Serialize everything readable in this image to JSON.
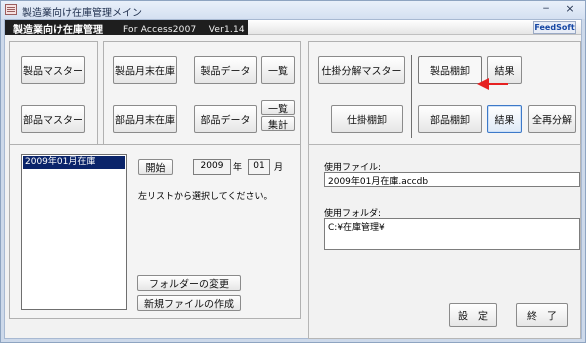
{
  "window": {
    "title": "製造業向け在庫管理メイン",
    "minimize": "−",
    "close": "×"
  },
  "header": {
    "app_name": "製造業向け在庫管理",
    "subtitle": "For Access2007　 Ver1.14",
    "feedsoft": "FeedSoft"
  },
  "left_buttons": {
    "product_master": "製品マスター",
    "parts_master": "部品マスター"
  },
  "center_buttons": {
    "product_month_end": "製品月末在庫",
    "parts_month_end": "部品月末在庫",
    "product_data": "製品データ",
    "product_list": "一覧",
    "parts_data": "部品データ",
    "parts_list": "一覧",
    "parts_total": "集計"
  },
  "right_buttons": {
    "wip_master": "仕掛分解マスター",
    "wip_inventory": "仕掛棚卸",
    "product_inventory": "製品棚卸",
    "product_result": "結果",
    "parts_inventory": "部品棚卸",
    "parts_result": "結果",
    "full_decompose": "全再分解"
  },
  "month_list": {
    "items": [
      "2009年01月在庫"
    ]
  },
  "period": {
    "start_button": "開始",
    "year_value": "2009",
    "year_label": "年",
    "month_value": "01",
    "month_label": "月",
    "instruction": "左リストから選択してください。"
  },
  "folder_actions": {
    "change_folder": "フォルダーの変更",
    "new_file": "新規ファイルの作成"
  },
  "files": {
    "file_label": "使用ファイル:",
    "file_value": "2009年01月在庫.accdb",
    "folder_label": "使用フォルダ:",
    "folder_value": "C:¥在庫管理¥"
  },
  "footer_buttons": {
    "settings": "設　定",
    "exit": "終　了"
  }
}
